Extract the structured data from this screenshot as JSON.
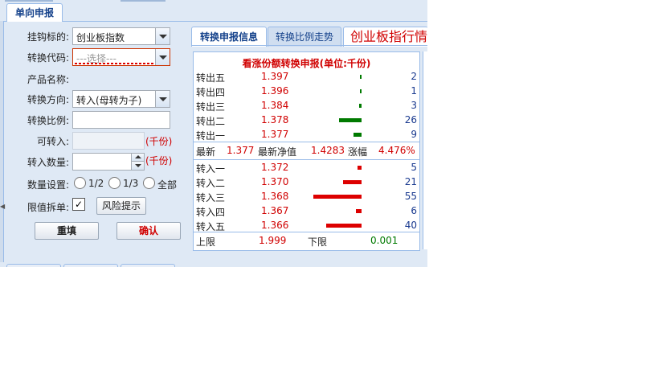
{
  "window": {
    "main_tab": "单向申报"
  },
  "form": {
    "subscription_target_label": "挂钩标的:",
    "subscription_target_value": "创业板指数",
    "conversion_code_label": "转换代码:",
    "conversion_code_placeholder": "---选择---",
    "product_name_label": "产品名称:",
    "direction_label": "转换方向:",
    "direction_value": "转入(母转为子)",
    "ratio_label": "转换比例:",
    "available_label": "可转入:",
    "available_unit": "(千份)",
    "quantity_label": "转入数量:",
    "quantity_unit": "(千份)",
    "quantity_setting_label": "数量设置:",
    "quantity_options": [
      "1/2",
      "1/3",
      "全部"
    ],
    "limit_split_label": "限值拆单:",
    "limit_split_checked": "✓",
    "risk_button": "风险提示",
    "reset_button": "重填",
    "confirm_button": "确认"
  },
  "right_tabs": {
    "tab1": "转换申报信息",
    "tab2": "转换比例走势",
    "marquee": "创业板指行情"
  },
  "colors": {
    "sell_bar": "#007a00",
    "buy_bar": "#dd0000",
    "price": "#d00000",
    "qty": "#1a3a8f"
  },
  "order_book": {
    "title": "看涨份额转换申报(单位:千份)",
    "sell": [
      {
        "name": "转出五",
        "price": "1.397",
        "qty": "2",
        "level": 0.04
      },
      {
        "name": "转出四",
        "price": "1.396",
        "qty": "1",
        "level": 0.02
      },
      {
        "name": "转出三",
        "price": "1.384",
        "qty": "3",
        "level": 0.05
      },
      {
        "name": "转出二",
        "price": "1.378",
        "qty": "26",
        "level": 0.47
      },
      {
        "name": "转出一",
        "price": "1.377",
        "qty": "9",
        "level": 0.16
      }
    ],
    "latest": {
      "latest_label": "最新",
      "latest_value": "1.377",
      "nav_label": "最新净值",
      "nav_value": "1.4283",
      "change_label": "涨幅",
      "change_value": "4.476%"
    },
    "buy": [
      {
        "name": "转入一",
        "price": "1.372",
        "qty": "5",
        "level": 0.09
      },
      {
        "name": "转入二",
        "price": "1.370",
        "qty": "21",
        "level": 0.38
      },
      {
        "name": "转入三",
        "price": "1.368",
        "qty": "55",
        "level": 1.0
      },
      {
        "name": "转入四",
        "price": "1.367",
        "qty": "6",
        "level": 0.11
      },
      {
        "name": "转入五",
        "price": "1.366",
        "qty": "40",
        "level": 0.73
      }
    ],
    "limits": {
      "upper_label": "上限",
      "upper_value": "1.999",
      "lower_label": "下限",
      "lower_value": "0.001"
    }
  }
}
